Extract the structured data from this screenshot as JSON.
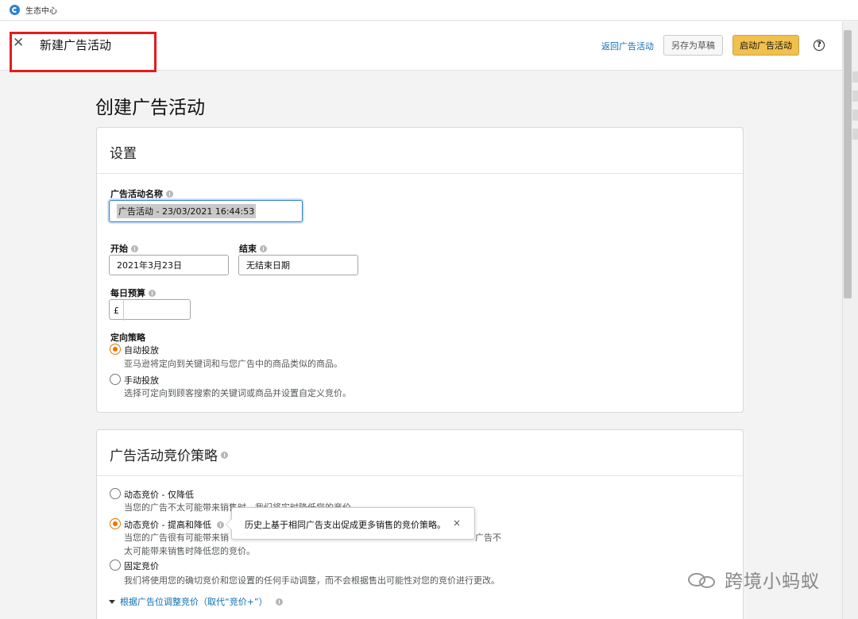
{
  "app": {
    "title": "生态中心"
  },
  "header": {
    "title": "新建广告活动",
    "back_link": "返回广告活动",
    "save_draft": "另存为草稿",
    "launch": "启动广告活动",
    "help": "?"
  },
  "page": {
    "title": "创建广告活动"
  },
  "settings": {
    "heading": "设置",
    "name_label": "广告活动名称",
    "name_value": "广告活动 - 23/03/2021 16:44:53",
    "start_label": "开始",
    "start_value": "2021年3月23日",
    "end_label": "结束",
    "end_value": "无结束日期",
    "budget_label": "每日预算",
    "budget_currency": "£",
    "budget_value": "",
    "targeting_label": "定向策略",
    "targeting_options": [
      {
        "label": "自动投放",
        "desc": "亚马逊将定向到关键词和与您广告中的商品类似的商品。",
        "selected": true
      },
      {
        "label": "手动投放",
        "desc": "选择可定向到顾客搜索的关键词或商品并设置自定义竞价。",
        "selected": false
      }
    ]
  },
  "bidding": {
    "heading": "广告活动竞价策略",
    "options": [
      {
        "label": "动态竞价 - 仅降低",
        "desc": "当您的广告不太可能带来销售时，我们将实时降低您的竞价。",
        "selected": false
      },
      {
        "label": "动态竞价 - 提高和降低",
        "desc_line1": "当您的广告很有可能带来销",
        "desc_line1_right": "广告不",
        "desc_line2": "太可能带来销售时降低您的竞价。",
        "selected": true
      },
      {
        "label": "固定竞价",
        "desc": "我们将使用您的确切竞价和您设置的任何手动调整，而不会根据售出可能性对您的竞价进行更改。",
        "selected": false
      }
    ],
    "tooltip": "历史上基于相同广告支出促成更多销售的竞价策略。",
    "tooltip_close": "×",
    "adjust_link": "根据广告位调整竞价（取代“竞价+”）"
  },
  "watermark": {
    "text": "跨境小蚂蚁"
  },
  "colors": {
    "accent": "#e77600",
    "link": "#0a6eb4",
    "launch_button": "#f1c04d",
    "highlight": "#e51b1b"
  }
}
